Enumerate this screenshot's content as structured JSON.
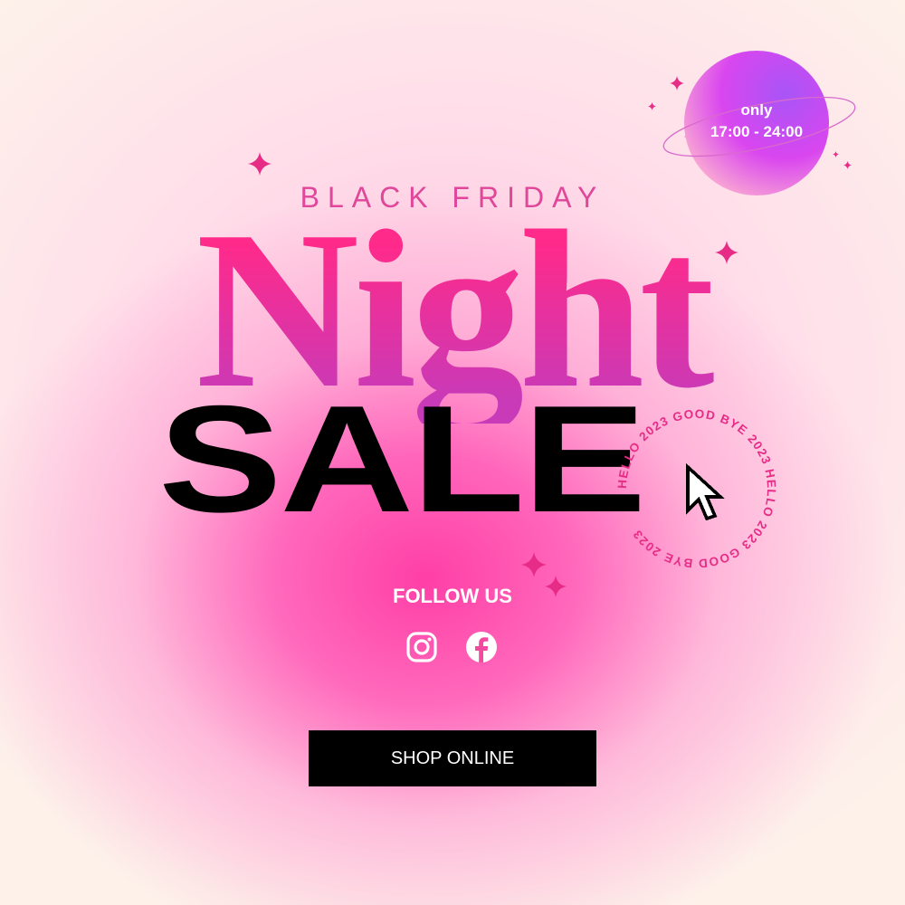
{
  "header": {
    "eyebrow": "BLACK FRIDAY"
  },
  "headline": {
    "script_word": "Night",
    "block_word": "SALE"
  },
  "badge": {
    "line1": "only",
    "line2": "17:00 - 24:00"
  },
  "ring_text": "HELLO 2023 GOOD BYE 2023 HELLO 2023 GOOD BYE 2023",
  "social": {
    "heading": "FOLLOW US",
    "icons": [
      "instagram-icon",
      "facebook-icon"
    ]
  },
  "cta": {
    "label": "SHOP ONLINE"
  },
  "colors": {
    "accent": "#e62c86",
    "eyebrow": "#e0479a",
    "button_bg": "#000000",
    "button_text": "#ffffff",
    "planet": "#c04df0"
  }
}
